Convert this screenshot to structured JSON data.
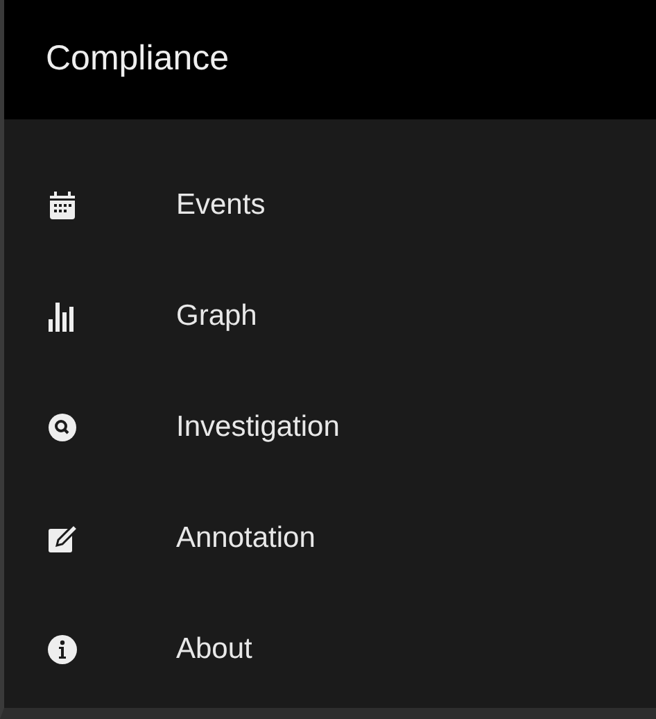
{
  "header": {
    "title": "Compliance"
  },
  "menu": {
    "items": [
      {
        "label": "Events"
      },
      {
        "label": "Graph"
      },
      {
        "label": "Investigation"
      },
      {
        "label": "Annotation"
      },
      {
        "label": "About"
      }
    ]
  }
}
